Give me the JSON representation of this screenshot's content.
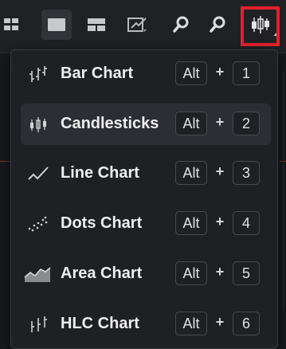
{
  "toolbar": {
    "icons": [
      "grid-layout-icon",
      "single-layout-icon",
      "split-layout-icon",
      "draw-tools-icon",
      "zoom-in-icon",
      "zoom-out-icon",
      "chart-type-icon"
    ],
    "highlight_color": "#e3202a"
  },
  "menu": {
    "items": [
      {
        "label": "Bar Chart",
        "icon": "bar-chart-icon",
        "modifier": "Alt",
        "plus": "+",
        "key": "1",
        "selected": false
      },
      {
        "label": "Candlesticks",
        "icon": "candlesticks-icon",
        "modifier": "Alt",
        "plus": "+",
        "key": "2",
        "selected": true
      },
      {
        "label": "Line Chart",
        "icon": "line-chart-icon",
        "modifier": "Alt",
        "plus": "+",
        "key": "3",
        "selected": false
      },
      {
        "label": "Dots Chart",
        "icon": "dots-chart-icon",
        "modifier": "Alt",
        "plus": "+",
        "key": "4",
        "selected": false
      },
      {
        "label": "Area Chart",
        "icon": "area-chart-icon",
        "modifier": "Alt",
        "plus": "+",
        "key": "5",
        "selected": false
      },
      {
        "label": "HLC Chart",
        "icon": "hlc-chart-icon",
        "modifier": "Alt",
        "plus": "+",
        "key": "6",
        "selected": false
      }
    ]
  }
}
